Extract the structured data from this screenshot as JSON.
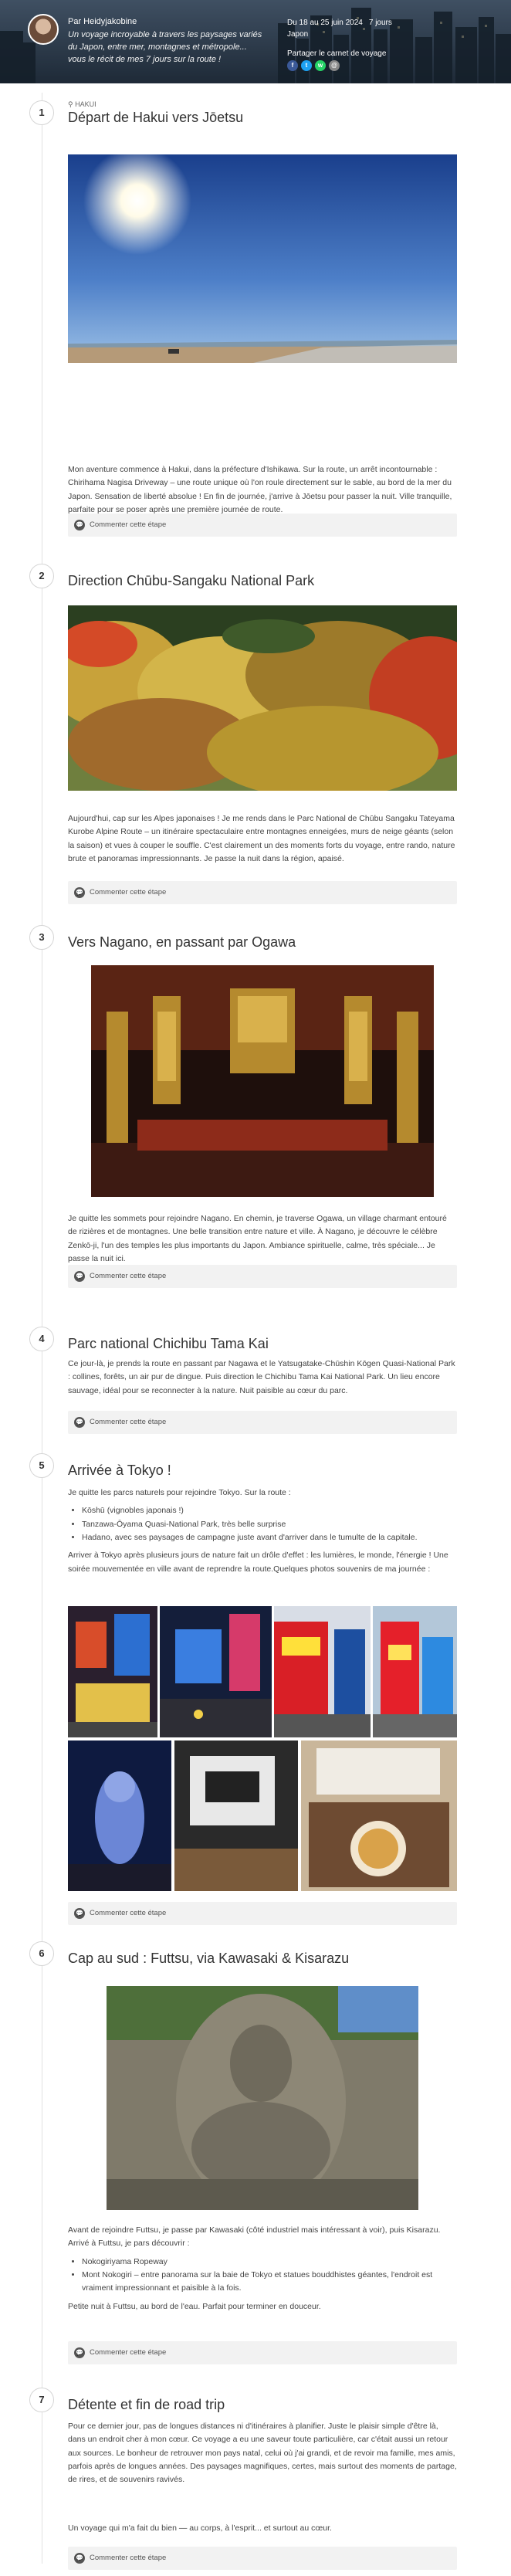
{
  "header": {
    "author": "Par Heidyjakobine",
    "description": "Un voyage incroyable à travers les paysages variés du Japon, entre mer, montagnes et métropole... vous le récit de mes 7 jours sur la route !",
    "dates": "Du 18 au 25 juin 2024",
    "duration": "7 jours",
    "country": "Japon",
    "share_label": "Partager le carnet de voyage",
    "share_icons": [
      "facebook-icon",
      "twitter-icon",
      "whatsapp-icon",
      "email-icon"
    ]
  },
  "steps": [
    {
      "number": "1",
      "tag": "HAKUI",
      "title": "Départ de Hakui vers Jōetsu",
      "text": "Mon aventure commence à Hakui, dans la préfecture d'Ishikawa. Sur la route, un arrêt incontournable : Chirihama Nagisa Driveway – une route unique où l'on roule directement sur le sable, au bord de la mer du Japon. Sensation de liberté absolue ! En fin de journée, j'arrive à Jōetsu pour passer la nuit. Ville tranquille, parfaite pour se poser après une première journée de route.",
      "comment": "Commenter cette étape"
    },
    {
      "number": "2",
      "title": "Direction Chūbu-Sangaku National Park",
      "text": "Aujourd'hui, cap sur les Alpes japonaises ! Je me rends dans le Parc National de Chūbu Sangaku Tateyama Kurobe Alpine Route – un itinéraire spectaculaire entre montagnes enneigées, murs de neige géants (selon la saison) et vues à couper le souffle. C'est clairement un des moments forts du voyage, entre rando, nature brute et panoramas impressionnants. Je passe la nuit dans la région, apaisé.",
      "comment": "Commenter cette étape"
    },
    {
      "number": "3",
      "title": "Vers Nagano, en passant par Ogawa",
      "text": "Je quitte les sommets pour rejoindre Nagano. En chemin, je traverse Ogawa, un village charmant entouré de rizières et de montagnes. Une belle transition entre nature et ville. À Nagano, je découvre le célèbre Zenkō-ji, l'un des temples les plus importants du Japon. Ambiance spirituelle, calme, très spéciale... Je passe la nuit ici.",
      "comment": "Commenter cette étape"
    },
    {
      "number": "4",
      "title": "Parc national Chichibu Tama Kai",
      "text": "Ce jour-là, je prends la route en passant par Nagawa et le Yatsugatake-Chūshin Kōgen Quasi-National Park : collines, forêts, un air pur de dingue. Puis direction le Chichibu Tama Kai National Park. Un lieu encore sauvage, idéal pour se reconnecter à la nature. Nuit paisible au cœur du parc.",
      "comment": "Commenter cette étape"
    },
    {
      "number": "5",
      "title": "Arrivée à Tokyo !",
      "intro": "Je quitte les parcs naturels pour rejoindre Tokyo. Sur la route :",
      "list": [
        "Kōshū (vignobles japonais !)",
        "Tanzawa-Ōyama Quasi-National Park, très belle surprise",
        "Hadano, avec ses paysages de campagne juste avant d'arriver dans le tumulte de la capitale."
      ],
      "outro": "Arriver à Tokyo après plusieurs jours de nature fait un drôle d'effet : les lumières, le monde, l'énergie ! Une soirée mouvementée en ville avant de reprendre la route.Quelques photos souvenirs de ma journée :",
      "comment": "Commenter cette étape"
    },
    {
      "number": "6",
      "title": "Cap au sud : Futtsu, via Kawasaki & Kisarazu",
      "intro": "Avant de rejoindre Futtsu, je passe par Kawasaki (côté industriel mais intéressant à voir), puis Kisarazu. Arrivé à Futtsu, je pars découvrir :",
      "list": [
        "Nokogiriyama Ropeway",
        "Mont Nokogiri – entre panorama sur la baie de Tokyo et statues bouddhistes géantes, l'endroit est vraiment impressionnant et paisible à la fois."
      ],
      "outro": "Petite nuit à Futtsu, au bord de l'eau. Parfait pour terminer en douceur.",
      "comment": "Commenter cette étape"
    },
    {
      "number": "7",
      "title": "Détente et fin de road trip",
      "text": "Pour ce dernier jour, pas de longues distances ni d'itinéraires à planifier. Juste le plaisir simple d'être là, dans un endroit cher à mon cœur. Ce voyage a eu une saveur toute particulière, car c'était aussi un retour aux sources. Le bonheur de retrouver mon pays natal, celui où j'ai grandi, et de revoir ma famille, mes amis, parfois après de longues années. Des paysages magnifiques, certes, mais surtout des moments de partage, de rires, et de souvenirs ravivés.",
      "closing": "Un voyage qui m'a fait du bien — au corps, à l'esprit... et surtout au cœur.",
      "comment": "Commenter cette étape"
    }
  ]
}
